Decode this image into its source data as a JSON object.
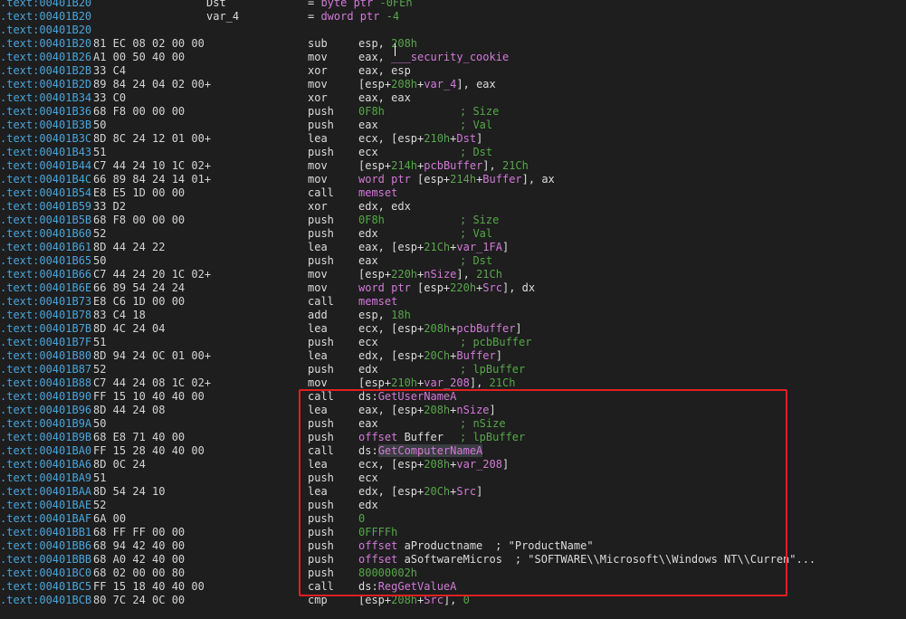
{
  "disassembly": {
    "header": [
      {
        "addr": ".text:00401B20",
        "name": "Dst",
        "parts": [
          [
            "plain",
            "= "
          ],
          [
            "kw",
            "byte ptr "
          ],
          [
            "num",
            "-0FEh"
          ]
        ]
      },
      {
        "addr": ".text:00401B20",
        "name": "var_4",
        "parts": [
          [
            "plain",
            "= "
          ],
          [
            "kw",
            "dword ptr "
          ],
          [
            "num",
            "-4"
          ]
        ]
      },
      {
        "addr": ".text:00401B20",
        "name": "",
        "parts": []
      }
    ],
    "lines": [
      {
        "addr": ".text:00401B20",
        "bytes": "81 EC 08 02 00 00",
        "mnem": "sub",
        "ops": [
          [
            "plain",
            "esp, "
          ],
          [
            "num",
            "208h"
          ]
        ]
      },
      {
        "addr": ".text:00401B26",
        "bytes": "A1 00 50 40 00",
        "mnem": "mov",
        "ops": [
          [
            "plain",
            "eax, "
          ],
          [
            "sym",
            "___security_cookie"
          ]
        ]
      },
      {
        "addr": ".text:00401B2B",
        "bytes": "33 C4",
        "mnem": "xor",
        "ops": [
          [
            "plain",
            "eax, esp"
          ]
        ]
      },
      {
        "addr": ".text:00401B2D",
        "bytes": "89 84 24 04 02 00+",
        "mnem": "mov",
        "ops": [
          [
            "plain",
            "[esp+"
          ],
          [
            "num",
            "208h"
          ],
          [
            "plain",
            "+"
          ],
          [
            "sym",
            "var_4"
          ],
          [
            "plain",
            "], eax"
          ]
        ]
      },
      {
        "addr": ".text:00401B34",
        "bytes": "33 C0",
        "mnem": "xor",
        "ops": [
          [
            "plain",
            "eax, eax"
          ]
        ]
      },
      {
        "addr": ".text:00401B36",
        "bytes": "68 F8 00 00 00",
        "mnem": "push",
        "ops": [
          [
            "num",
            "0F8h"
          ]
        ],
        "cmt": "; Size"
      },
      {
        "addr": ".text:00401B3B",
        "bytes": "50",
        "mnem": "push",
        "ops": [
          [
            "plain",
            "eax"
          ]
        ],
        "cmt": "; Val"
      },
      {
        "addr": ".text:00401B3C",
        "bytes": "8D 8C 24 12 01 00+",
        "mnem": "lea",
        "ops": [
          [
            "plain",
            "ecx, [esp+"
          ],
          [
            "num",
            "210h"
          ],
          [
            "plain",
            "+"
          ],
          [
            "sym",
            "Dst"
          ],
          [
            "plain",
            "]"
          ]
        ]
      },
      {
        "addr": ".text:00401B43",
        "bytes": "51",
        "mnem": "push",
        "ops": [
          [
            "plain",
            "ecx"
          ]
        ],
        "cmt": "; Dst"
      },
      {
        "addr": ".text:00401B44",
        "bytes": "C7 44 24 10 1C 02+",
        "mnem": "mov",
        "ops": [
          [
            "plain",
            "[esp+"
          ],
          [
            "num",
            "214h"
          ],
          [
            "plain",
            "+"
          ],
          [
            "sym",
            "pcbBuffer"
          ],
          [
            "plain",
            "], "
          ],
          [
            "num",
            "21Ch"
          ]
        ]
      },
      {
        "addr": ".text:00401B4C",
        "bytes": "66 89 84 24 14 01+",
        "mnem": "mov",
        "ops": [
          [
            "kw",
            "word ptr "
          ],
          [
            "plain",
            "[esp+"
          ],
          [
            "num",
            "214h"
          ],
          [
            "plain",
            "+"
          ],
          [
            "sym",
            "Buffer"
          ],
          [
            "plain",
            "], ax"
          ]
        ]
      },
      {
        "addr": ".text:00401B54",
        "bytes": "E8 E5 1D 00 00",
        "mnem": "call",
        "ops": [
          [
            "sym",
            "memset"
          ]
        ]
      },
      {
        "addr": ".text:00401B59",
        "bytes": "33 D2",
        "mnem": "xor",
        "ops": [
          [
            "plain",
            "edx, edx"
          ]
        ]
      },
      {
        "addr": ".text:00401B5B",
        "bytes": "68 F8 00 00 00",
        "mnem": "push",
        "ops": [
          [
            "num",
            "0F8h"
          ]
        ],
        "cmt": "; Size"
      },
      {
        "addr": ".text:00401B60",
        "bytes": "52",
        "mnem": "push",
        "ops": [
          [
            "plain",
            "edx"
          ]
        ],
        "cmt": "; Val"
      },
      {
        "addr": ".text:00401B61",
        "bytes": "8D 44 24 22",
        "mnem": "lea",
        "ops": [
          [
            "plain",
            "eax, [esp+"
          ],
          [
            "num",
            "21Ch"
          ],
          [
            "plain",
            "+"
          ],
          [
            "sym",
            "var_1FA"
          ],
          [
            "plain",
            "]"
          ]
        ]
      },
      {
        "addr": ".text:00401B65",
        "bytes": "50",
        "mnem": "push",
        "ops": [
          [
            "plain",
            "eax"
          ]
        ],
        "cmt": "; Dst"
      },
      {
        "addr": ".text:00401B66",
        "bytes": "C7 44 24 20 1C 02+",
        "mnem": "mov",
        "ops": [
          [
            "plain",
            "[esp+"
          ],
          [
            "num",
            "220h"
          ],
          [
            "plain",
            "+"
          ],
          [
            "sym",
            "nSize"
          ],
          [
            "plain",
            "], "
          ],
          [
            "num",
            "21Ch"
          ]
        ]
      },
      {
        "addr": ".text:00401B6E",
        "bytes": "66 89 54 24 24",
        "mnem": "mov",
        "ops": [
          [
            "kw",
            "word ptr "
          ],
          [
            "plain",
            "[esp+"
          ],
          [
            "num",
            "220h"
          ],
          [
            "plain",
            "+"
          ],
          [
            "sym",
            "Src"
          ],
          [
            "plain",
            "], dx"
          ]
        ]
      },
      {
        "addr": ".text:00401B73",
        "bytes": "E8 C6 1D 00 00",
        "mnem": "call",
        "ops": [
          [
            "sym",
            "memset"
          ]
        ]
      },
      {
        "addr": ".text:00401B78",
        "bytes": "83 C4 18",
        "mnem": "add",
        "ops": [
          [
            "plain",
            "esp, "
          ],
          [
            "num",
            "18h"
          ]
        ]
      },
      {
        "addr": ".text:00401B7B",
        "bytes": "8D 4C 24 04",
        "mnem": "lea",
        "ops": [
          [
            "plain",
            "ecx, [esp+"
          ],
          [
            "num",
            "208h"
          ],
          [
            "plain",
            "+"
          ],
          [
            "sym",
            "pcbBuffer"
          ],
          [
            "plain",
            "]"
          ]
        ]
      },
      {
        "addr": ".text:00401B7F",
        "bytes": "51",
        "mnem": "push",
        "ops": [
          [
            "plain",
            "ecx"
          ]
        ],
        "cmt": "; pcbBuffer"
      },
      {
        "addr": ".text:00401B80",
        "bytes": "8D 94 24 0C 01 00+",
        "mnem": "lea",
        "ops": [
          [
            "plain",
            "edx, [esp+"
          ],
          [
            "num",
            "20Ch"
          ],
          [
            "plain",
            "+"
          ],
          [
            "sym",
            "Buffer"
          ],
          [
            "plain",
            "]"
          ]
        ]
      },
      {
        "addr": ".text:00401B87",
        "bytes": "52",
        "mnem": "push",
        "ops": [
          [
            "plain",
            "edx"
          ]
        ],
        "cmt": "; lpBuffer"
      },
      {
        "addr": ".text:00401B88",
        "bytes": "C7 44 24 08 1C 02+",
        "mnem": "mov",
        "ops": [
          [
            "plain",
            "[esp+"
          ],
          [
            "num",
            "210h"
          ],
          [
            "plain",
            "+"
          ],
          [
            "sym",
            "var_208"
          ],
          [
            "plain",
            "], "
          ],
          [
            "num",
            "21Ch"
          ]
        ]
      },
      {
        "addr": ".text:00401B90",
        "bytes": "FF 15 10 40 40 00",
        "mnem": "call",
        "ops": [
          [
            "plain",
            "ds:"
          ],
          [
            "sym",
            "GetUserNameA"
          ]
        ]
      },
      {
        "addr": ".text:00401B96",
        "bytes": "8D 44 24 08",
        "mnem": "lea",
        "ops": [
          [
            "plain",
            "eax, [esp+"
          ],
          [
            "num",
            "208h"
          ],
          [
            "plain",
            "+"
          ],
          [
            "sym",
            "nSize"
          ],
          [
            "plain",
            "]"
          ]
        ]
      },
      {
        "addr": ".text:00401B9A",
        "bytes": "50",
        "mnem": "push",
        "ops": [
          [
            "plain",
            "eax"
          ]
        ],
        "cmt": "; nSize"
      },
      {
        "addr": ".text:00401B9B",
        "bytes": "68 E8 71 40 00",
        "mnem": "push",
        "ops": [
          [
            "kw",
            "offset "
          ],
          [
            "plain",
            "Buffer"
          ]
        ],
        "cmt": "; lpBuffer"
      },
      {
        "addr": ".text:00401BA0",
        "bytes": "FF 15 28 40 40 00",
        "mnem": "call",
        "ops": [
          [
            "plain",
            "ds:"
          ],
          [
            "sym",
            "GetComputerNameA"
          ]
        ],
        "selected": true
      },
      {
        "addr": ".text:00401BA6",
        "bytes": "8D 0C 24",
        "mnem": "lea",
        "ops": [
          [
            "plain",
            "ecx, [esp+"
          ],
          [
            "num",
            "208h"
          ],
          [
            "plain",
            "+"
          ],
          [
            "sym",
            "var_208"
          ],
          [
            "plain",
            "]"
          ]
        ]
      },
      {
        "addr": ".text:00401BA9",
        "bytes": "51",
        "mnem": "push",
        "ops": [
          [
            "plain",
            "ecx"
          ]
        ]
      },
      {
        "addr": ".text:00401BAA",
        "bytes": "8D 54 24 10",
        "mnem": "lea",
        "ops": [
          [
            "plain",
            "edx, [esp+"
          ],
          [
            "num",
            "20Ch"
          ],
          [
            "plain",
            "+"
          ],
          [
            "sym",
            "Src"
          ],
          [
            "plain",
            "]"
          ]
        ]
      },
      {
        "addr": ".text:00401BAE",
        "bytes": "52",
        "mnem": "push",
        "ops": [
          [
            "plain",
            "edx"
          ]
        ]
      },
      {
        "addr": ".text:00401BAF",
        "bytes": "6A 00",
        "mnem": "push",
        "ops": [
          [
            "num",
            "0"
          ]
        ]
      },
      {
        "addr": ".text:00401BB1",
        "bytes": "68 FF FF 00 00",
        "mnem": "push",
        "ops": [
          [
            "num",
            "0FFFFh"
          ]
        ]
      },
      {
        "addr": ".text:00401BB6",
        "bytes": "68 94 42 40 00",
        "mnem": "push",
        "ops": [
          [
            "kw",
            "offset "
          ],
          [
            "plain",
            "aProductname"
          ]
        ],
        "cmt": "; \"ProductName\"",
        "cmtStyle": "str"
      },
      {
        "addr": ".text:00401BBB",
        "bytes": "68 A0 42 40 00",
        "mnem": "push",
        "ops": [
          [
            "kw",
            "offset "
          ],
          [
            "plain",
            "aSoftwareMicros"
          ]
        ],
        "cmt": "; \"SOFTWARE\\\\Microsoft\\\\Windows NT\\\\Curren\"...",
        "cmtStyle": "str"
      },
      {
        "addr": ".text:00401BC0",
        "bytes": "68 02 00 00 80",
        "mnem": "push",
        "ops": [
          [
            "num",
            "80000002h"
          ]
        ]
      },
      {
        "addr": ".text:00401BC5",
        "bytes": "FF 15 18 40 40 00",
        "mnem": "call",
        "ops": [
          [
            "plain",
            "ds:"
          ],
          [
            "sym",
            "RegGetValueA"
          ]
        ]
      },
      {
        "addr": ".text:00401BCB",
        "bytes": "80 7C 24 0C 00",
        "mnem": "cmp",
        "ops": [
          [
            "plain",
            "[esp+"
          ],
          [
            "num",
            "208h"
          ],
          [
            "plain",
            "+"
          ],
          [
            "sym",
            "Src"
          ],
          [
            "plain",
            "], "
          ],
          [
            "num",
            "0"
          ]
        ]
      }
    ]
  },
  "highlight": {
    "color": "#e02020"
  }
}
